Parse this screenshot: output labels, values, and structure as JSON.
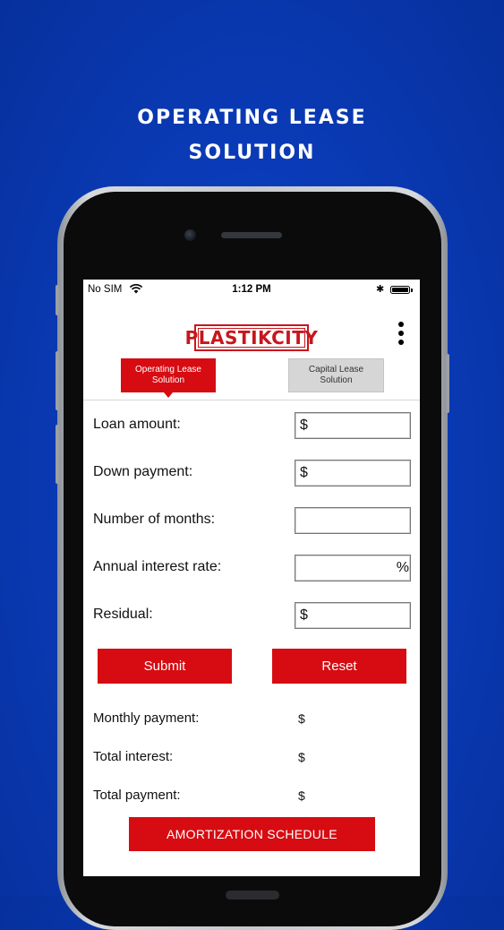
{
  "headline": {
    "line1": "OPERATING LEASE",
    "line2": "SOLUTION"
  },
  "status_bar": {
    "carrier": "No SIM",
    "time": "1:12 PM",
    "bluetooth": "✱"
  },
  "app": {
    "logo_text": "PLASTIKCITY",
    "menu_icon": "more-vertical-icon",
    "tabs": [
      {
        "label": "Operating Lease Solution",
        "active": true
      },
      {
        "label": "Capital Lease Solution",
        "active": false
      }
    ]
  },
  "form": {
    "fields": [
      {
        "label": "Loan amount:",
        "prefix": "$",
        "suffix": "",
        "value": ""
      },
      {
        "label": "Down payment:",
        "prefix": "$",
        "suffix": "",
        "value": ""
      },
      {
        "label": "Number of months:",
        "prefix": "",
        "suffix": "",
        "value": ""
      },
      {
        "label": "Annual interest rate:",
        "prefix": "",
        "suffix": "%",
        "value": ""
      },
      {
        "label": "Residual:",
        "prefix": "$",
        "suffix": "",
        "value": ""
      }
    ],
    "submit_label": "Submit",
    "reset_label": "Reset"
  },
  "results": [
    {
      "label": "Monthly payment:",
      "value": "$"
    },
    {
      "label": "Total interest:",
      "value": "$"
    },
    {
      "label": "Total payment:",
      "value": "$"
    }
  ],
  "amortization_label": "AMORTIZATION SCHEDULE",
  "colors": {
    "background": "#0a3bb8",
    "accent_red": "#d60c12",
    "inactive_tab": "#d6d6d6"
  }
}
